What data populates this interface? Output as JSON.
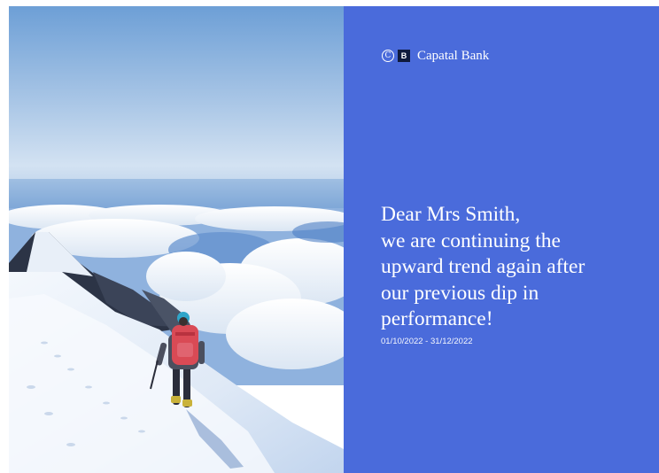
{
  "photo": {
    "alt": "Mountaineer with red backpack hiking on a snowy ridge above a sea of clouds"
  },
  "brand": {
    "logo_letter_1": "C",
    "logo_letter_2": "B",
    "name": "Capatal Bank"
  },
  "message": {
    "lines": [
      "Dear Mrs Smith,",
      "we are continuing the",
      "upward trend again after",
      "our previous dip in",
      "performance!"
    ]
  },
  "period": "01/10/2022 - 31/12/2022",
  "colors": {
    "panel_background": "#4a6bdb",
    "logo_square": "#0f1a3c",
    "text": "#ffffff"
  }
}
